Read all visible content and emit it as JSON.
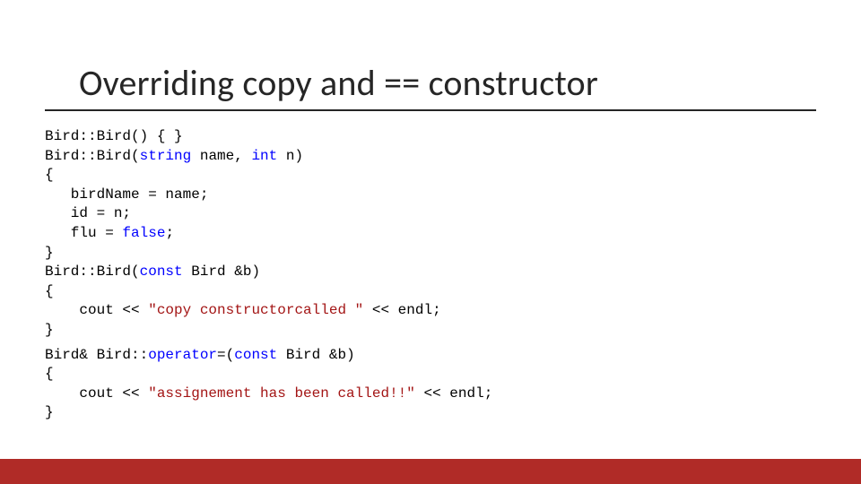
{
  "title": "Overriding copy and == constructor",
  "code": {
    "l1a": "Bird::Bird() { }",
    "l2a": "Bird::Bird(",
    "l2b": "string",
    "l2c": " name, ",
    "l2d": "int",
    "l2e": " n)",
    "l3a": "{",
    "l4a": "   birdName = name;",
    "l5a": "   id = n;",
    "l6a": "   flu = ",
    "l6b": "false",
    "l6c": ";",
    "l7a": "}",
    "l8a": "Bird::Bird(",
    "l8b": "const",
    "l8c": " Bird &b)",
    "l9a": "{",
    "l10a": "    cout << ",
    "l10b": "\"copy constructorcalled \"",
    "l10c": " << endl;",
    "l11a": "}",
    "l12a": "Bird& Bird::",
    "l12b": "operator",
    "l12c": "=(",
    "l12d": "const",
    "l12e": " Bird &b)",
    "l13a": "{",
    "l14a": "    cout << ",
    "l14b": "\"assignement has been called!!\"",
    "l14c": " << endl;",
    "l15a": "}"
  }
}
